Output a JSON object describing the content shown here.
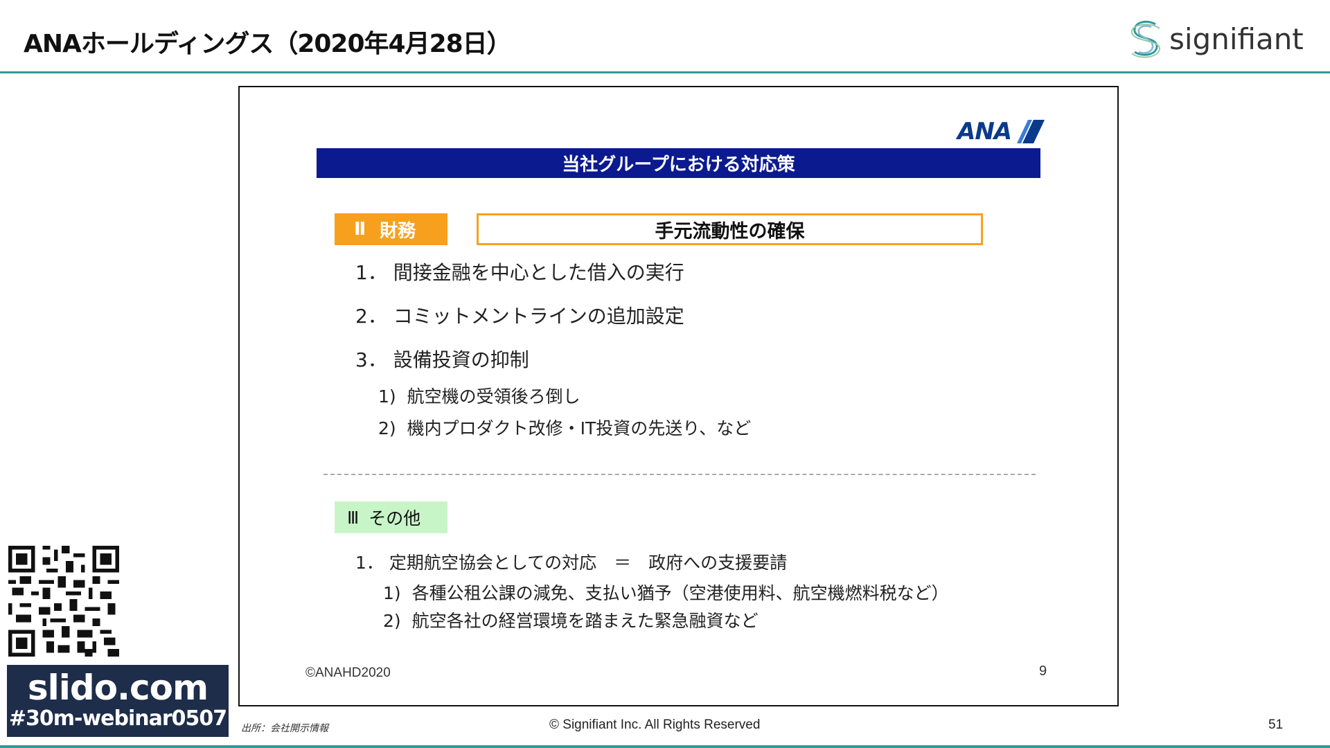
{
  "header": {
    "title": "ANAホールディングス（2020年4月28日）",
    "brand_name": "signifiant",
    "brand_icon": "signifiant-s-logo-icon",
    "accent_color": "#2f9a9c"
  },
  "slide": {
    "logo_text": "ANA",
    "logo_icon": "ana-stripe-icon",
    "heading": "当社グループにおける対応策",
    "heading_color": "#0b1a8f",
    "section_ii": {
      "numeral": "Ⅱ",
      "label": "財務",
      "box_title": "手元流動性の確保",
      "color": "#f7a01d",
      "items": [
        {
          "num": "1．",
          "text": "間接金融を中心とした借入の実行"
        },
        {
          "num": "2．",
          "text": "コミットメントラインの追加設定"
        },
        {
          "num": "3．",
          "text": "設備投資の抑制"
        }
      ],
      "subitems": [
        {
          "num": "1)",
          "text": "航空機の受領後ろ倒し"
        },
        {
          "num": "2)",
          "text": "機内プロダクト改修・IT投資の先送り、など"
        }
      ]
    },
    "section_iii": {
      "numeral": "Ⅲ",
      "label": "その他",
      "color": "#c8f5c8",
      "items": [
        {
          "num": "1．",
          "text": "定期航空協会としての対応　＝　政府への支援要請"
        }
      ],
      "subitems": [
        {
          "num": "1)",
          "text": "各種公租公課の減免、支払い猶予（空港使用料、航空機燃料税など）"
        },
        {
          "num": "2)",
          "text": "航空各社の経営環境を踏まえた緊急融資など"
        }
      ]
    },
    "copyright": "©ANAHD2020",
    "page_number": "9"
  },
  "slido": {
    "url": "slido.com",
    "hashtag": "#30m-webinar0507",
    "qr_icon": "qr-code-icon"
  },
  "footer": {
    "source": "出所：会社開示情報",
    "copyright": "© Signifiant Inc. All Rights Reserved",
    "page_number": "51"
  }
}
